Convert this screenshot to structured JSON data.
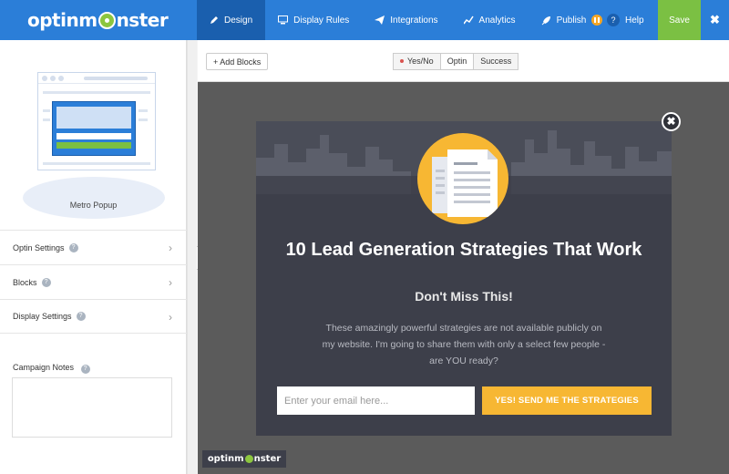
{
  "app": {
    "logo_text_pre": "optinm",
    "logo_text_post": "nster"
  },
  "nav": {
    "items": [
      {
        "label": "Design",
        "icon": "pencil-icon"
      },
      {
        "label": "Display Rules",
        "icon": "monitor-icon"
      },
      {
        "label": "Integrations",
        "icon": "paper-plane-icon"
      },
      {
        "label": "Analytics",
        "icon": "chart-icon"
      },
      {
        "label": "Publish",
        "icon": "rocket-icon"
      }
    ],
    "help_label": "Help",
    "save_label": "Save",
    "close_glyph": "✖"
  },
  "sidebar": {
    "template_name": "Metro Popup",
    "rows": [
      {
        "label": "Optin Settings"
      },
      {
        "label": "Blocks"
      },
      {
        "label": "Display Settings"
      }
    ],
    "notes_label": "Campaign Notes",
    "notes_value": ""
  },
  "toolbar": {
    "add_blocks_label": "+ Add Blocks",
    "views": [
      {
        "label": "Yes/No",
        "active": false
      },
      {
        "label": "Optin",
        "active": true
      },
      {
        "label": "Success",
        "active": false
      }
    ]
  },
  "popup": {
    "title": "10 Lead Generation Strategies That Work",
    "subtitle": "Don't Miss This!",
    "body": "These amazingly powerful strategies are not available publicly on my website. I'm going to share them with only a select few people - are YOU ready?",
    "email_placeholder": "Enter your email here...",
    "cta_label": "YES! SEND ME THE STRATEGIES",
    "close_glyph": "✖"
  },
  "brand": {
    "pre": "optinm",
    "post": "nster"
  },
  "colors": {
    "topbar": "#2b7ed8",
    "active_nav": "#1a5fae",
    "save": "#7bc043",
    "popup_bg": "#3d3f4a",
    "accent": "#f7b733"
  }
}
